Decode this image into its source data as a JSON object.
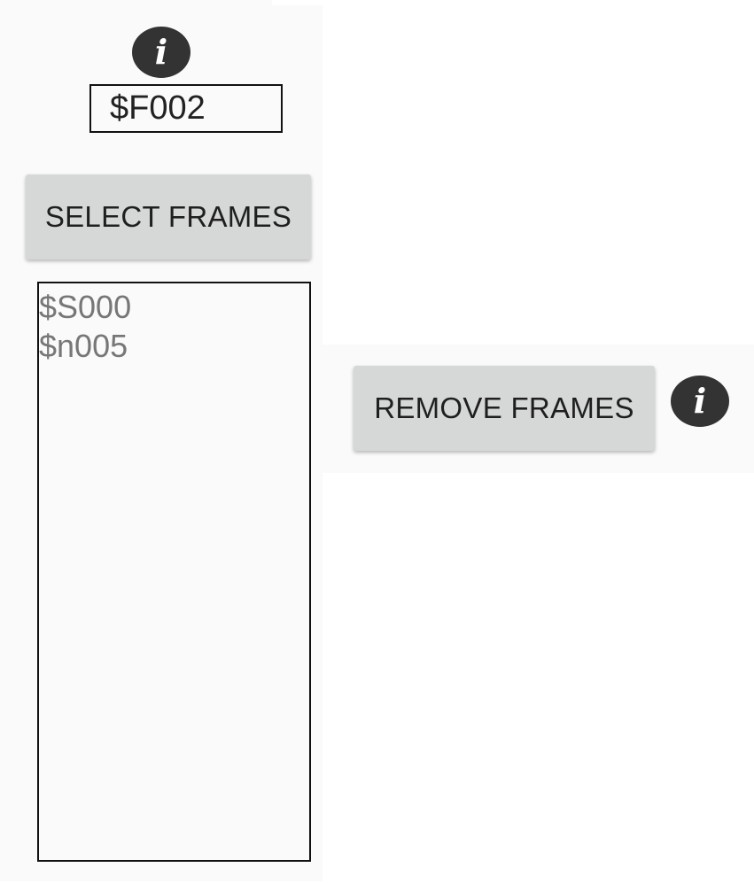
{
  "frame_field": {
    "value": "$F002"
  },
  "select_button": {
    "label": "SELECT FRAMES"
  },
  "frames_list": {
    "items": [
      "$S000",
      "$n005"
    ]
  },
  "remove_button": {
    "label": "REMOVE FRAMES"
  },
  "icons": {
    "info_top": "info-icon",
    "info_right": "info-icon",
    "glyph": "i"
  },
  "colors": {
    "panel_bg": "#fafafa",
    "button_bg": "#d6d7d7",
    "icon_bg": "#333333",
    "list_text": "#777777"
  }
}
